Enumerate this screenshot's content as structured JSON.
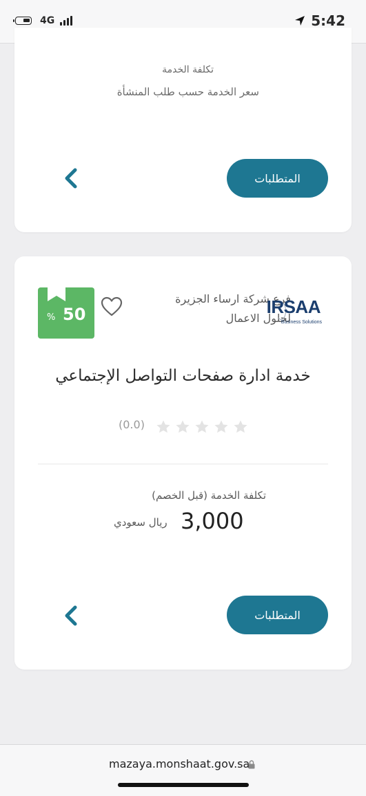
{
  "status_bar": {
    "network": "4G",
    "time": "5:42"
  },
  "top_card": {
    "cost_label": "تكلفة الخدمة",
    "cost_value": "سعر الخدمة حسب طلب المنشأة",
    "requirements_label": "المتطلبات"
  },
  "service_card": {
    "discount_value": "50",
    "discount_unit": "%",
    "company_name": "فرع شركة ارساء الجزيرة لحلول الاعمال",
    "logo_text": "IRSAA",
    "logo_subtext": "Business Solutions",
    "title": "خدمة ادارة صفحات التواصل الإجتماعي",
    "rating": 0,
    "rating_max": 5,
    "rating_text": "(0.0)",
    "price_label": "تكلفة الخدمة (قبل الخصم)",
    "price_amount": "3,000",
    "price_currency": "ريال سعودي",
    "requirements_label": "المتطلبات"
  },
  "browser": {
    "url": "mazaya.monshaat.gov.sa"
  },
  "colors": {
    "primary": "#1e7792",
    "discount_badge": "#5cb765",
    "star_empty": "#e3e3e3"
  }
}
